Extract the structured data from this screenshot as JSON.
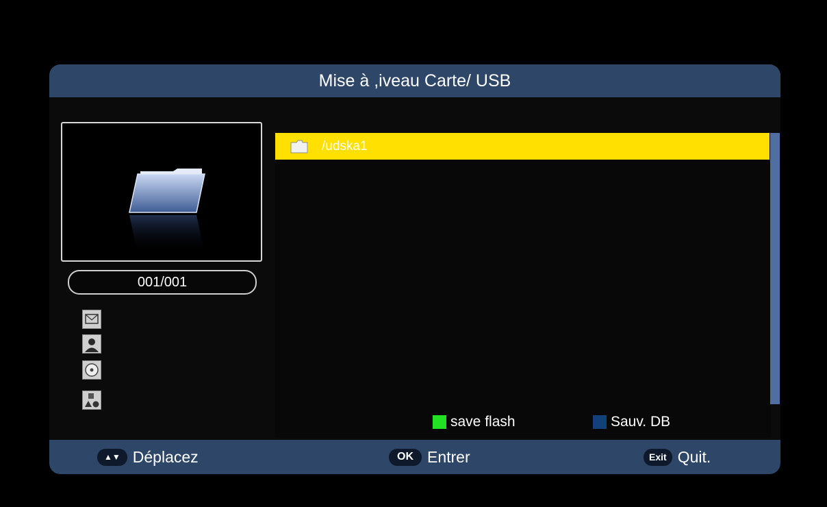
{
  "window": {
    "title": "Mise à ,iveau Carte/ USB"
  },
  "preview": {
    "counter": "001/001",
    "folder_icon": "folder-icon"
  },
  "media_icons": [
    "image-icon",
    "user-icon",
    "disc-icon",
    "shapes-icon"
  ],
  "file_list": {
    "items": [
      {
        "name": "/udska1",
        "icon": "folder-icon",
        "selected": true
      }
    ]
  },
  "legend": {
    "green": {
      "label": "save flash",
      "color": "#22e022"
    },
    "blue": {
      "label": "Sauv. DB",
      "color": "#12417a"
    }
  },
  "footer": {
    "move": {
      "key": "▲▼",
      "label": "Déplacez"
    },
    "ok": {
      "key": "OK",
      "label": "Entrer"
    },
    "exit": {
      "key": "Exit",
      "label": "Quit."
    }
  },
  "colors": {
    "highlight": "#ffe000",
    "bar": "#2e4668",
    "scroll": "#506fa0"
  }
}
